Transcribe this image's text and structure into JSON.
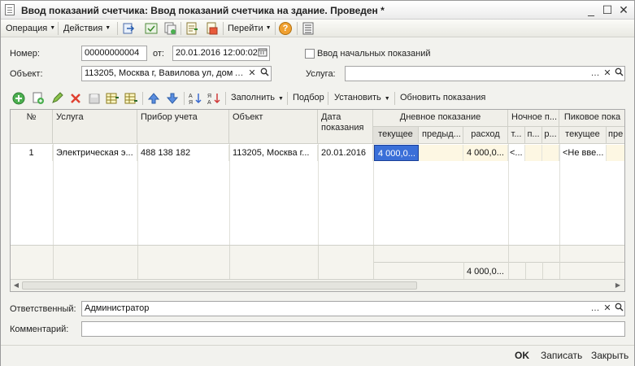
{
  "window": {
    "title": "Ввод показаний счетчика: Ввод показаний счетчика на здание. Проведен *",
    "minimize": "_",
    "maximize": "☐",
    "close": "✕"
  },
  "toolbar": {
    "operation": "Операция",
    "actions": "Действия",
    "goto": "Перейти",
    "help": "?"
  },
  "form": {
    "number_label": "Номер:",
    "number_value": "00000000004",
    "from_label": "от:",
    "date_value": "20.01.2016 12:00:02",
    "initial_checkbox_label": "Ввод начальных показаний",
    "initial_checked": false,
    "object_label": "Объект:",
    "object_value": "113205, Москва г, Вавилова ул, дом",
    "service_label": "Услуга:",
    "service_value": "",
    "responsible_label": "Ответственный:",
    "responsible_value": "Администратор",
    "comment_label": "Комментарий:",
    "comment_value": ""
  },
  "table_toolbar": {
    "fill": "Заполнить",
    "pick": "Подбор",
    "set": "Установить",
    "refresh": "Обновить показания"
  },
  "table": {
    "headers": {
      "num": "№",
      "service": "Услуга",
      "device": "Прибор учета",
      "object": "Объект",
      "date": "Дата показания",
      "day": "Дневное показание",
      "night": "Ночное п...",
      "peak": "Пиковое пока"
    },
    "sub_headers": {
      "day_current": "текущее",
      "day_prev": "предыд...",
      "day_usage": "расход",
      "night_current": "т...",
      "night_prev": "п...",
      "night_usage": "р...",
      "peak_current": "текущее",
      "peak_prev": "пре"
    },
    "rows": [
      {
        "num": "1",
        "service": "Электрическая э...",
        "device": "488 138 182",
        "object": "113205, Москва г...",
        "date": "20.01.2016",
        "day_current": "4 000,0...",
        "day_prev": "",
        "day_usage": "4 000,0...",
        "night_current": "<...",
        "night_prev": "",
        "night_usage": "",
        "peak_current": "<Не вве...",
        "peak_prev": ""
      }
    ],
    "total_day_usage": "4 000,0..."
  },
  "buttons": {
    "ok": "OK",
    "save": "Записать",
    "close": "Закрыть"
  }
}
